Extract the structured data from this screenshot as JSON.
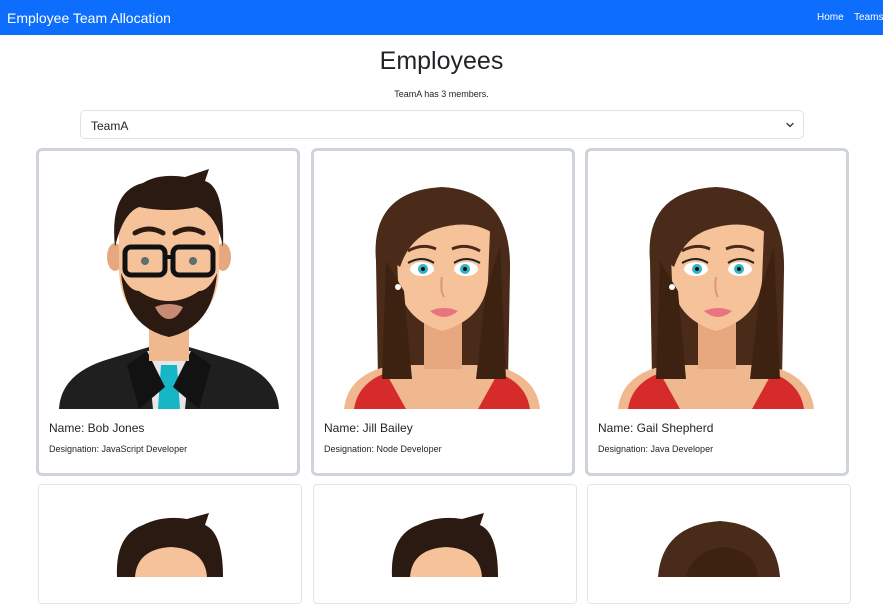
{
  "navbar": {
    "brand": "Employee Team Allocation",
    "links": [
      "Home",
      "Teams"
    ],
    "color": "#0d6efd"
  },
  "page": {
    "title": "Employees",
    "members_note": "TeamA has 3 members."
  },
  "team_select": {
    "value": "TeamA",
    "icon": "chevron-down-icon"
  },
  "employees": [
    {
      "name_label": "Name: Bob Jones",
      "designation_label": "Designation: JavaScript Developer",
      "avatar": "male-avatar-glasses-beard"
    },
    {
      "name_label": "Name: Jill Bailey",
      "designation_label": "Designation: Node Developer",
      "avatar": "female-avatar"
    },
    {
      "name_label": "Name: Gail Shepherd",
      "designation_label": "Designation: Java Developer",
      "avatar": "female-avatar"
    }
  ],
  "more_cards": [
    {
      "avatar": "male-avatar"
    },
    {
      "avatar": "male-avatar"
    },
    {
      "avatar": "female-avatar"
    }
  ]
}
